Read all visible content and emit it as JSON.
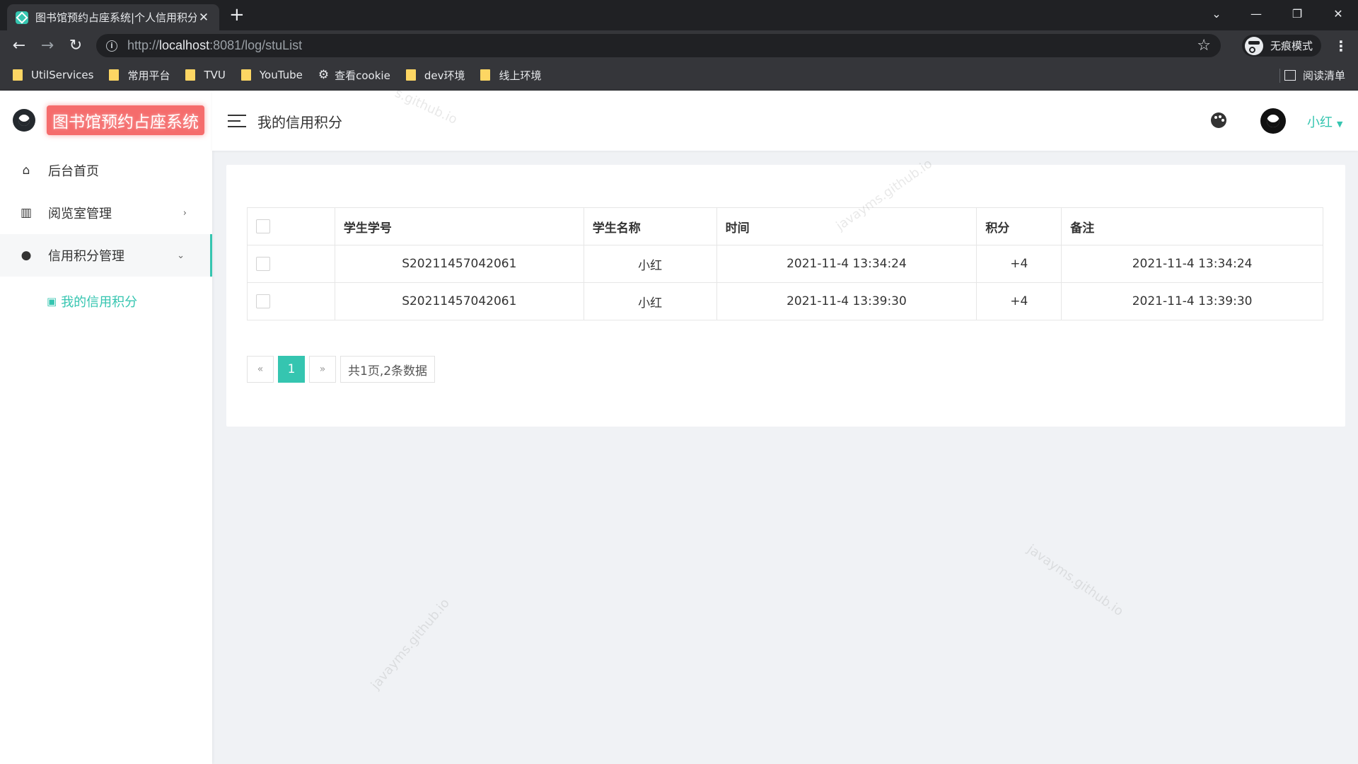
{
  "browser": {
    "tab_title": "图书馆预约占座系统|个人信用积分",
    "tab_close": "✕",
    "new_tab": "+",
    "url_prefix": "http://",
    "url_host": "localhost",
    "url_rest": ":8081/log/stuList",
    "incognito_label": "无痕模式",
    "bookmarks": [
      "UtilServices",
      "常用平台",
      "TVU",
      "YouTube",
      "查看cookie",
      "dev环境",
      "线上环境"
    ],
    "reading_list": "阅读清单"
  },
  "app": {
    "brand": "图书馆预约占座系统",
    "page_title": "我的信用积分",
    "user": "小红",
    "accent_color": "#35c5b0"
  },
  "sidebar": {
    "items": [
      {
        "label": "后台首页",
        "icon": "home-icon"
      },
      {
        "label": "阅览室管理",
        "icon": "book-icon"
      },
      {
        "label": "信用积分管理",
        "icon": "user-icon"
      }
    ],
    "submenu": {
      "label": "我的信用积分",
      "icon": "android-icon"
    }
  },
  "table": {
    "headers": [
      "学生学号",
      "学生名称",
      "时间",
      "积分",
      "备注"
    ],
    "rows": [
      [
        "S20211457042061",
        "小红",
        "2021-11-4 13:34:24",
        "+4",
        "2021-11-4 13:34:24"
      ],
      [
        "S20211457042061",
        "小红",
        "2021-11-4 13:39:30",
        "+4",
        "2021-11-4 13:39:30"
      ]
    ]
  },
  "pagination": {
    "prev": "«",
    "current": "1",
    "next": "»",
    "info": "共1页,2条数据"
  },
  "watermark": "javayms.github.io",
  "watermark_partial": "s.github.io"
}
